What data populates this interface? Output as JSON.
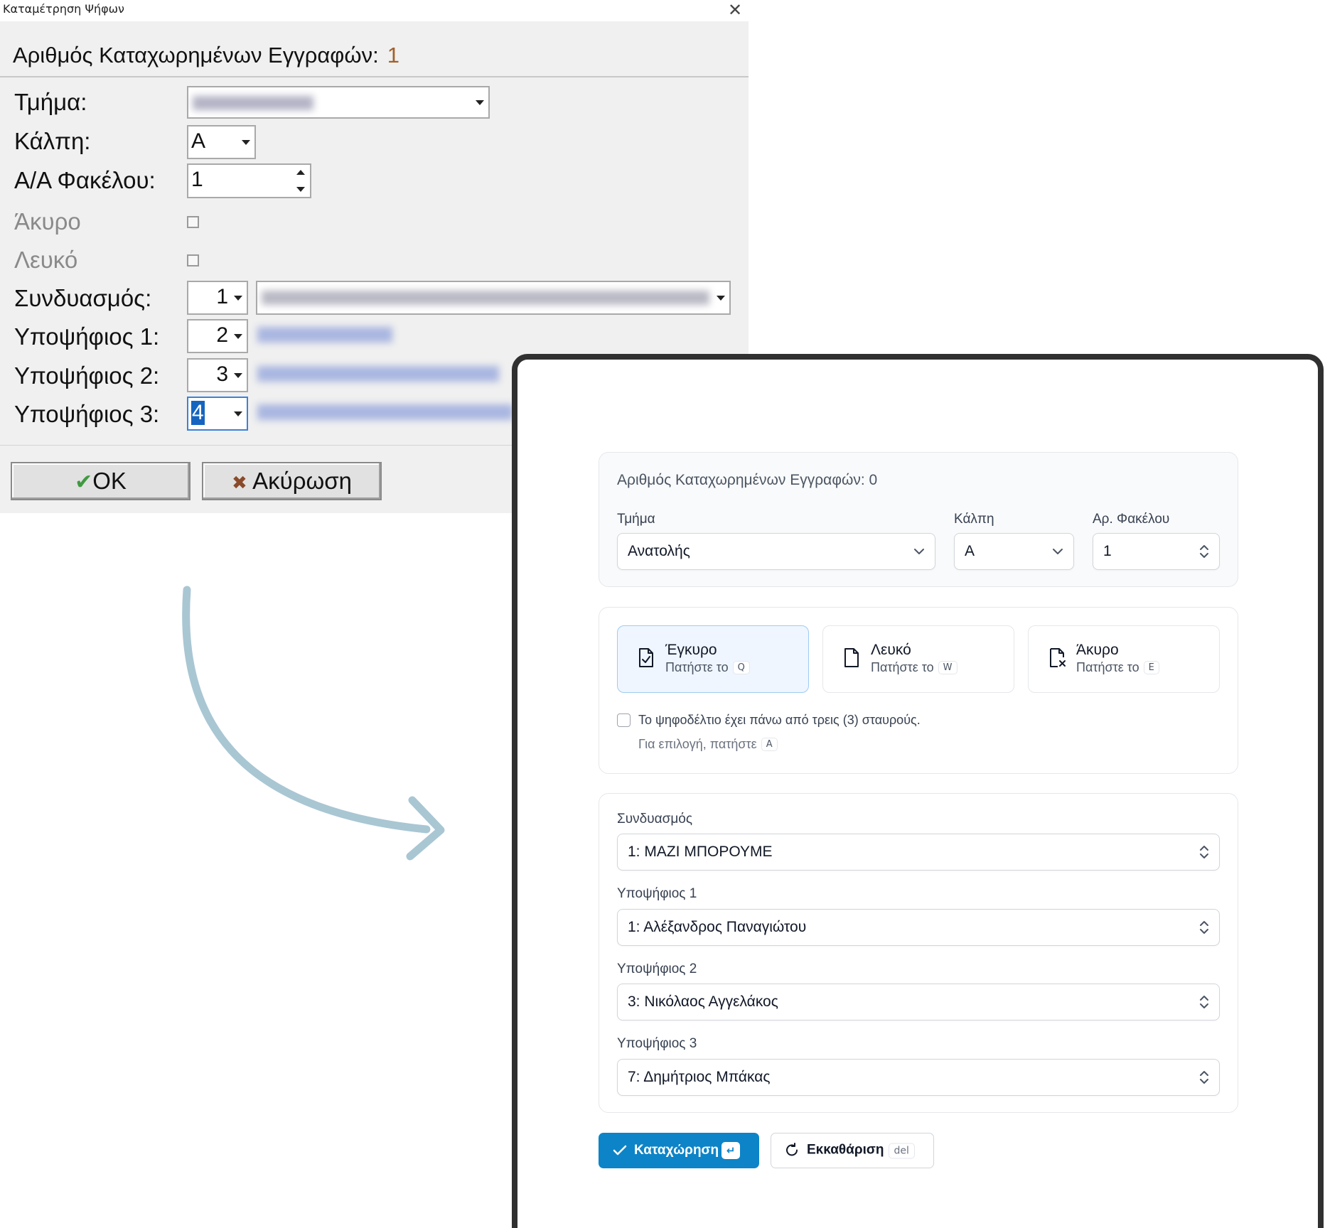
{
  "old_dialog": {
    "title": "Καταμέτρηση Ψήφων",
    "close_glyph": "✕",
    "count_label": "Αριθμός Καταχωρημένων Εγγραφών:",
    "count_value": "1",
    "labels": {
      "tmima": "Τμήμα:",
      "kalpi": "Κάλπη:",
      "fakelos": "Α/Α Φακέλου:",
      "akyro": "Άκυρο",
      "lefko": "Λευκό",
      "syndyasmos": "Συνδυασμός:",
      "ypopsifios1": "Υποψήφιος 1:",
      "ypopsifios2": "Υποψήφιος 2:",
      "ypopsifios3": "Υποψήφιος 3:"
    },
    "values": {
      "kalpi": "Α",
      "fakelos": "1",
      "syndyasmos": "1",
      "ypopsifios1": "2",
      "ypopsifios2": "3",
      "ypopsifios3": "4"
    },
    "buttons": {
      "ok": "OK",
      "cancel": "Ακύρωση"
    }
  },
  "new_form": {
    "count_label": "Αριθμός Καταχωρημένων Εγγραφών: 0",
    "fields": {
      "tmima_label": "Τμήμα",
      "tmima_value": "Ανατολής",
      "kalpi_label": "Κάλπη",
      "kalpi_value": "Α",
      "fakelos_label": "Αρ. Φακέλου",
      "fakelos_value": "1"
    },
    "ballot_options": [
      {
        "title": "Έγκυρο",
        "hint": "Πατήστε το",
        "key": "Q",
        "icon": "file-check-icon",
        "selected": true
      },
      {
        "title": "Λευκό",
        "hint": "Πατήστε το",
        "key": "W",
        "icon": "file-icon",
        "selected": false
      },
      {
        "title": "Άκυρο",
        "hint": "Πατήστε το",
        "key": "E",
        "icon": "file-x-icon",
        "selected": false
      }
    ],
    "checkbox": {
      "label": "Το ψηφοδέλτιο έχει πάνω από τρεις (3) σταυρούς.",
      "hint": "Για επιλογή, πατήστε",
      "key": "A"
    },
    "selections": [
      {
        "label": "Συνδυασμός",
        "value": "1: ΜΑΖΙ ΜΠΟΡΟΥΜΕ"
      },
      {
        "label": "Υποψήφιος 1",
        "value": "1: Αλέξανδρος Παναγιώτου"
      },
      {
        "label": "Υποψήφιος 2",
        "value": "3: Νικόλαος Αγγελάκος"
      },
      {
        "label": "Υποψήφιος 3",
        "value": "7: Δημήτριος Μπάκας"
      }
    ],
    "buttons": {
      "submit": "Καταχώρηση",
      "submit_key": "↵",
      "clear": "Εκκαθάριση",
      "clear_key": "del"
    }
  },
  "colors": {
    "primary": "#0d84c7",
    "arrow": "#a9c6d3",
    "old_count_accent": "#a0602a"
  }
}
